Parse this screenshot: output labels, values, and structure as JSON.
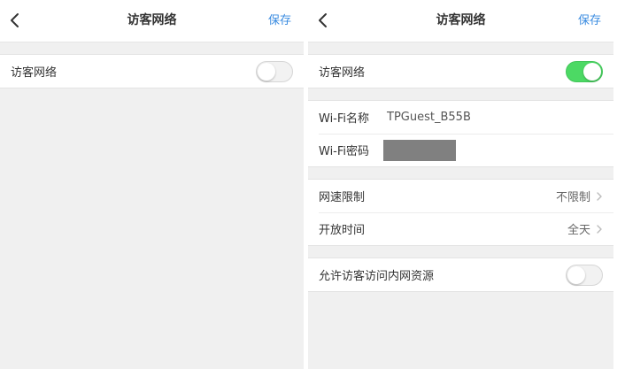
{
  "left_panel": {
    "navbar": {
      "title": "访客网络",
      "save_label": "保存"
    },
    "guest_network": {
      "label": "访客网络",
      "enabled": false
    }
  },
  "right_panel": {
    "navbar": {
      "title": "访客网络",
      "save_label": "保存"
    },
    "guest_network": {
      "label": "访客网络",
      "enabled": true
    },
    "wifi": {
      "name_label": "Wi-Fi名称",
      "name_value": "TPGuest_B55B",
      "password_label": "Wi-Fi密码",
      "password_masked": true
    },
    "speed_limit": {
      "label": "网速限制",
      "value": "不限制"
    },
    "open_time": {
      "label": "开放时间",
      "value": "全天"
    },
    "allow_intranet": {
      "label": "允许访客访问内网资源",
      "enabled": false
    }
  },
  "colors": {
    "accent": "#3a8be0",
    "toggle_on": "#4cd964",
    "background": "#f0f0f0"
  },
  "icons": [
    "chevron-left-icon",
    "chevron-right-icon"
  ]
}
